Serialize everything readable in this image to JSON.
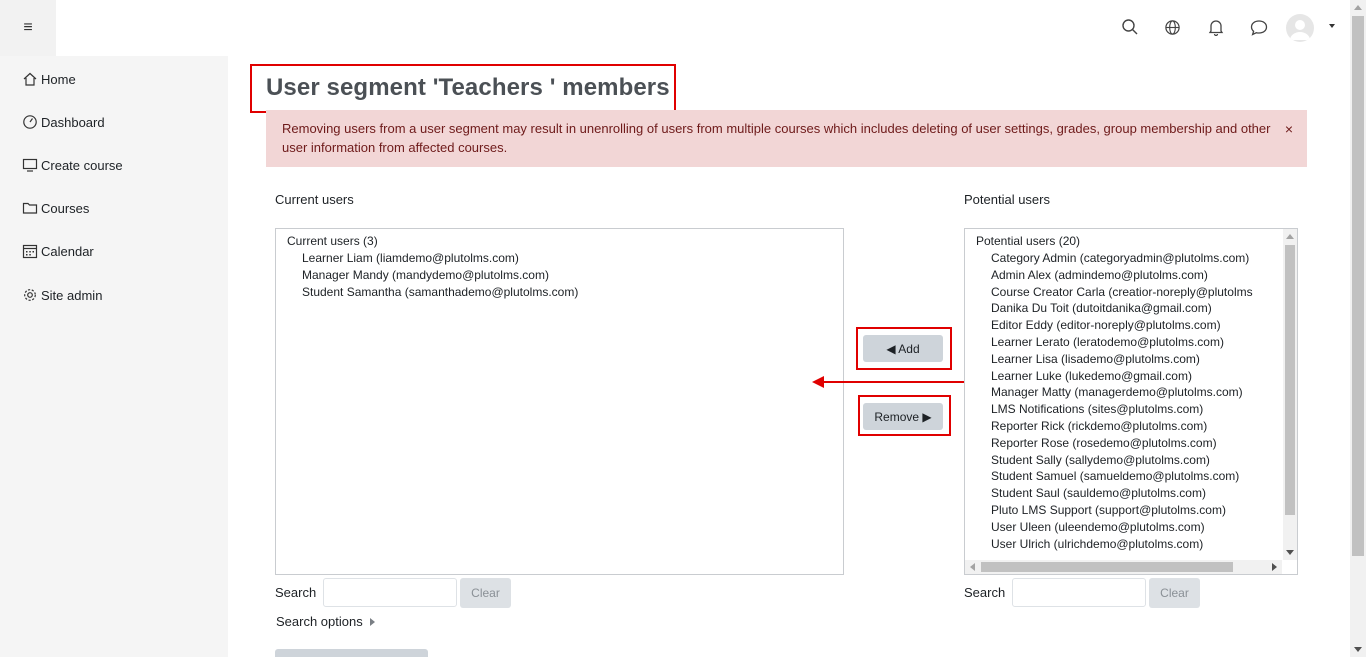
{
  "page": {
    "title": "User segment 'Teachers ' members",
    "alert": "Removing users from a user segment may result in unenrolling of users from multiple courses which includes deleting of user settings, grades, group membership and other user information from affected courses.",
    "alert_close": "×"
  },
  "sidebar": {
    "items": [
      {
        "label": "Home",
        "icon": "home-icon"
      },
      {
        "label": "Dashboard",
        "icon": "dashboard-icon"
      },
      {
        "label": "Create course",
        "icon": "monitor-icon"
      },
      {
        "label": "Courses",
        "icon": "folder-icon"
      },
      {
        "label": "Calendar",
        "icon": "calendar-icon"
      },
      {
        "label": "Site admin",
        "icon": "gear-icon"
      }
    ]
  },
  "navbar": {
    "menu_icon": "≡",
    "icons": [
      "search-icon",
      "globe-icon",
      "bell-icon",
      "chat-icon",
      "avatar",
      "caret-down-icon"
    ]
  },
  "current": {
    "label": "Current users",
    "group": "Current users (3)",
    "options": [
      "Learner Liam (liamdemo@plutolms.com)",
      "Manager Mandy (mandydemo@plutolms.com)",
      "Student Samantha (samanthademo@plutolms.com)"
    ],
    "search_label": "Search",
    "clear_label": "Clear"
  },
  "buttons": {
    "add": "◀ Add",
    "remove": "Remove ▶"
  },
  "potential": {
    "label": "Potential users",
    "group": "Potential users (20)",
    "options": [
      "Category Admin (categoryadmin@plutolms.com)",
      "Admin Alex (admindemo@plutolms.com)",
      "Course Creator Carla (creatior-noreply@plutolms",
      "Danika Du Toit (dutoitdanika@gmail.com)",
      "Editor Eddy (editor-noreply@plutolms.com)",
      "Learner Lerato (leratodemo@plutolms.com)",
      "Learner Lisa (lisademo@plutolms.com)",
      "Learner Luke (lukedemo@gmail.com)",
      "Manager Matty (managerdemo@plutolms.com)",
      "LMS Notifications (sites@plutolms.com)",
      "Reporter Rick (rickdemo@plutolms.com)",
      "Reporter Rose (rosedemo@plutolms.com)",
      "Student Sally (sallydemo@plutolms.com)",
      "Student Samuel (samueldemo@plutolms.com)",
      "Student Saul (sauldemo@plutolms.com)",
      "Pluto LMS Support (support@plutolms.com)",
      "User Uleen (uleendemo@plutolms.com)",
      "User Ulrich (ulrichdemo@plutolms.com)"
    ],
    "search_label": "Search",
    "clear_label": "Clear"
  },
  "search_options": "Search options",
  "colors": {
    "annotation_red": "#e00000",
    "alert_bg": "#f2d6d6",
    "button_grey": "#ced4da"
  }
}
